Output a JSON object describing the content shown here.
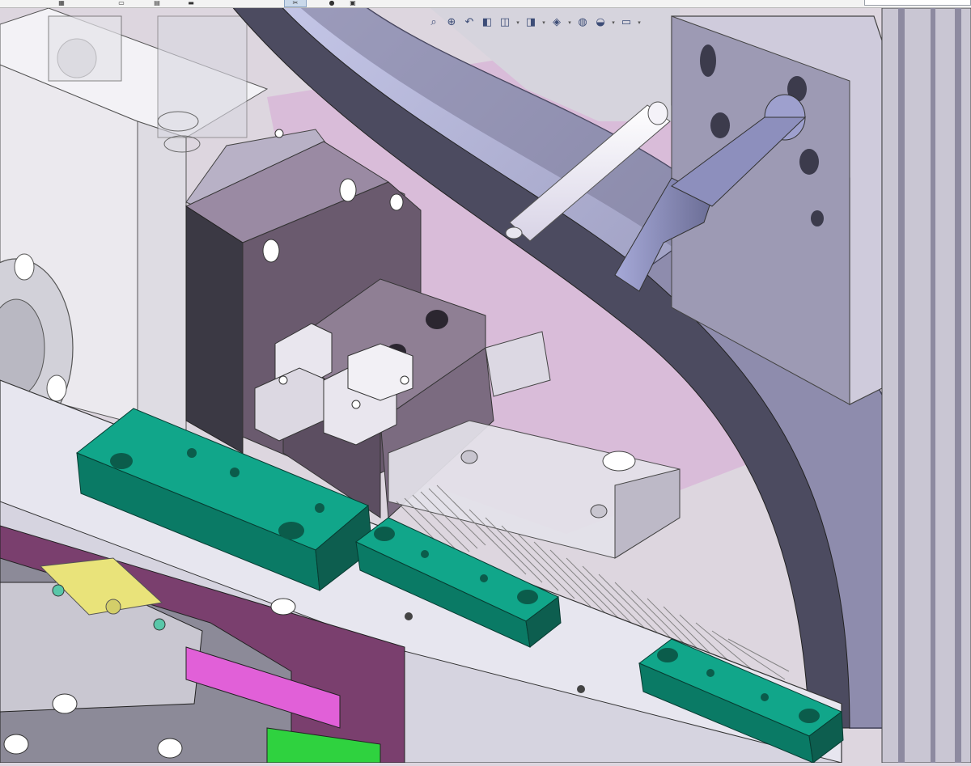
{
  "window": {
    "kind": "cad-graphics-area"
  },
  "top_toolbar": {
    "buttons": [
      {
        "icon": "grid-icon"
      },
      {
        "icon": "document-icon"
      },
      {
        "icon": "print-icon"
      },
      {
        "icon": "scissors-icon",
        "active": true
      },
      {
        "icon": "rebuild-icon"
      },
      {
        "icon": "options-icon"
      }
    ]
  },
  "heads_up_toolbar": {
    "buttons": [
      {
        "icon": "zoom-to-fit-icon"
      },
      {
        "icon": "zoom-to-area-icon"
      },
      {
        "icon": "previous-view-icon"
      },
      {
        "icon": "section-view-icon"
      },
      {
        "icon": "view-orientation-icon",
        "has_dropdown": true
      },
      {
        "icon": "display-style-icon",
        "has_dropdown": true
      },
      {
        "icon": "hide-show-items-icon",
        "has_dropdown": true
      },
      {
        "icon": "edit-appearance-icon"
      },
      {
        "icon": "apply-scene-icon",
        "has_dropdown": true
      },
      {
        "icon": "view-settings-icon",
        "has_dropdown": true
      }
    ]
  },
  "colors": {
    "teal_part": "#11a68a",
    "purple_plate": "#7a3f6e",
    "magenta_part": "#e160d8",
    "green_part": "#2fd23f",
    "yellow_part": "#e9e37a",
    "blue_strip": "#3d42c7",
    "gray_part": "#8c8a98",
    "background": "#ddd6df"
  }
}
